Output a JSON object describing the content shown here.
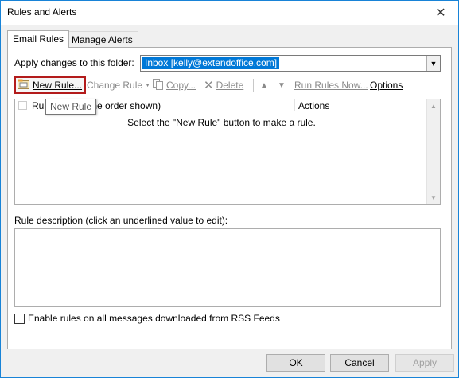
{
  "window": {
    "title": "Rules and Alerts",
    "close_glyph": "✕"
  },
  "tabs": [
    {
      "label": "Email Rules",
      "active": true
    },
    {
      "label": "Manage Alerts",
      "active": false
    }
  ],
  "folder": {
    "label": "Apply changes to this folder:",
    "value": "Inbox [kelly@extendoffice.com]"
  },
  "toolbar": {
    "new_rule": "New Rule...",
    "change_rule": "Change Rule",
    "copy": "Copy...",
    "delete": "Delete",
    "run_rules_now": "Run Rules Now...",
    "options": "Options"
  },
  "rules_table": {
    "col_rule_prefix": "Rul",
    "col_rule_rest": "the order shown)",
    "col_actions": "Actions",
    "empty_message": "Select the \"New Rule\" button to make a rule."
  },
  "tooltip": "New Rule",
  "description_label": "Rule description (click an underlined value to edit):",
  "rss_checkbox": {
    "label": "Enable rules on all messages downloaded from RSS Feeds",
    "checked": false
  },
  "buttons": {
    "ok": "OK",
    "cancel": "Cancel",
    "apply": "Apply"
  },
  "colors": {
    "accent": "#0078d7",
    "highlight_border": "#b31b1b"
  }
}
